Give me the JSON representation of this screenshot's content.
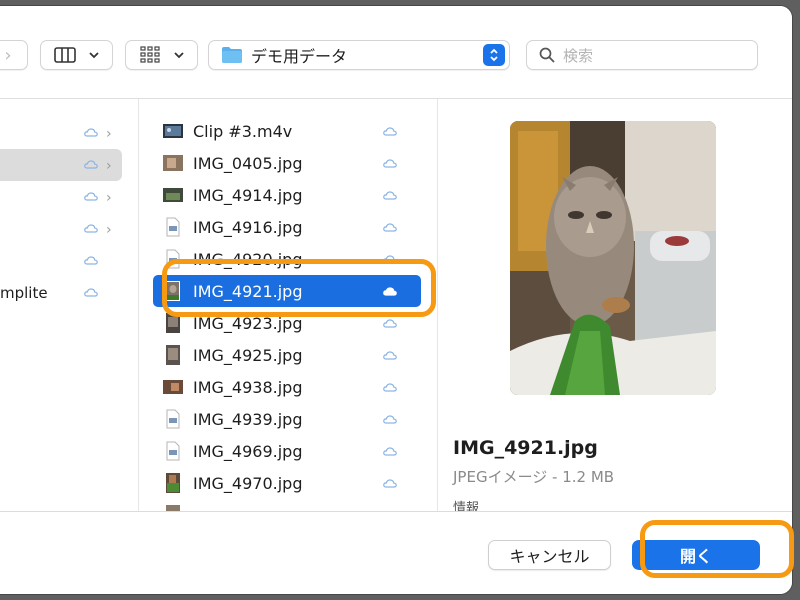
{
  "toolbar": {
    "path_label": "デモ用データ",
    "search_placeholder": "検索"
  },
  "sidebar": {
    "items": [
      {
        "label": "",
        "selected": false,
        "has_chevron": true
      },
      {
        "label": "",
        "selected": true,
        "has_chevron": true
      },
      {
        "label": "",
        "selected": false,
        "has_chevron": true
      },
      {
        "label": "",
        "selected": false,
        "has_chevron": true
      },
      {
        "label": "",
        "selected": false,
        "has_chevron": false
      },
      {
        "label": "mplite",
        "selected": false,
        "has_chevron": false
      }
    ]
  },
  "files": [
    {
      "name": "Clip #3.m4v",
      "thumb": "video",
      "selected": false
    },
    {
      "name": "IMG_0405.jpg",
      "thumb": "photo-warm",
      "selected": false
    },
    {
      "name": "IMG_4914.jpg",
      "thumb": "photo-green",
      "selected": false
    },
    {
      "name": "IMG_4916.jpg",
      "thumb": "doc",
      "selected": false
    },
    {
      "name": "IMG_4920.jpg",
      "thumb": "doc",
      "selected": false
    },
    {
      "name": "IMG_4921.jpg",
      "thumb": "photo-owl",
      "selected": true
    },
    {
      "name": "IMG_4923.jpg",
      "thumb": "photo-dark",
      "selected": false
    },
    {
      "name": "IMG_4925.jpg",
      "thumb": "photo-dark",
      "selected": false
    },
    {
      "name": "IMG_4938.jpg",
      "thumb": "photo-warm",
      "selected": false
    },
    {
      "name": "IMG_4939.jpg",
      "thumb": "doc",
      "selected": false
    },
    {
      "name": "IMG_4969.jpg",
      "thumb": "doc",
      "selected": false
    },
    {
      "name": "IMG_4970.jpg",
      "thumb": "photo-green",
      "selected": false
    }
  ],
  "preview": {
    "filename": "IMG_4921.jpg",
    "meta": "JPEGイメージ - 1.2 MB",
    "info_label": "情報"
  },
  "footer": {
    "cancel_label": "キャンセル",
    "open_label": "開く"
  },
  "colors": {
    "accent": "#1a73e8",
    "highlight": "#f59a12",
    "selection": "#1a6ee0",
    "cloud_icon": "#8fb4e3"
  }
}
